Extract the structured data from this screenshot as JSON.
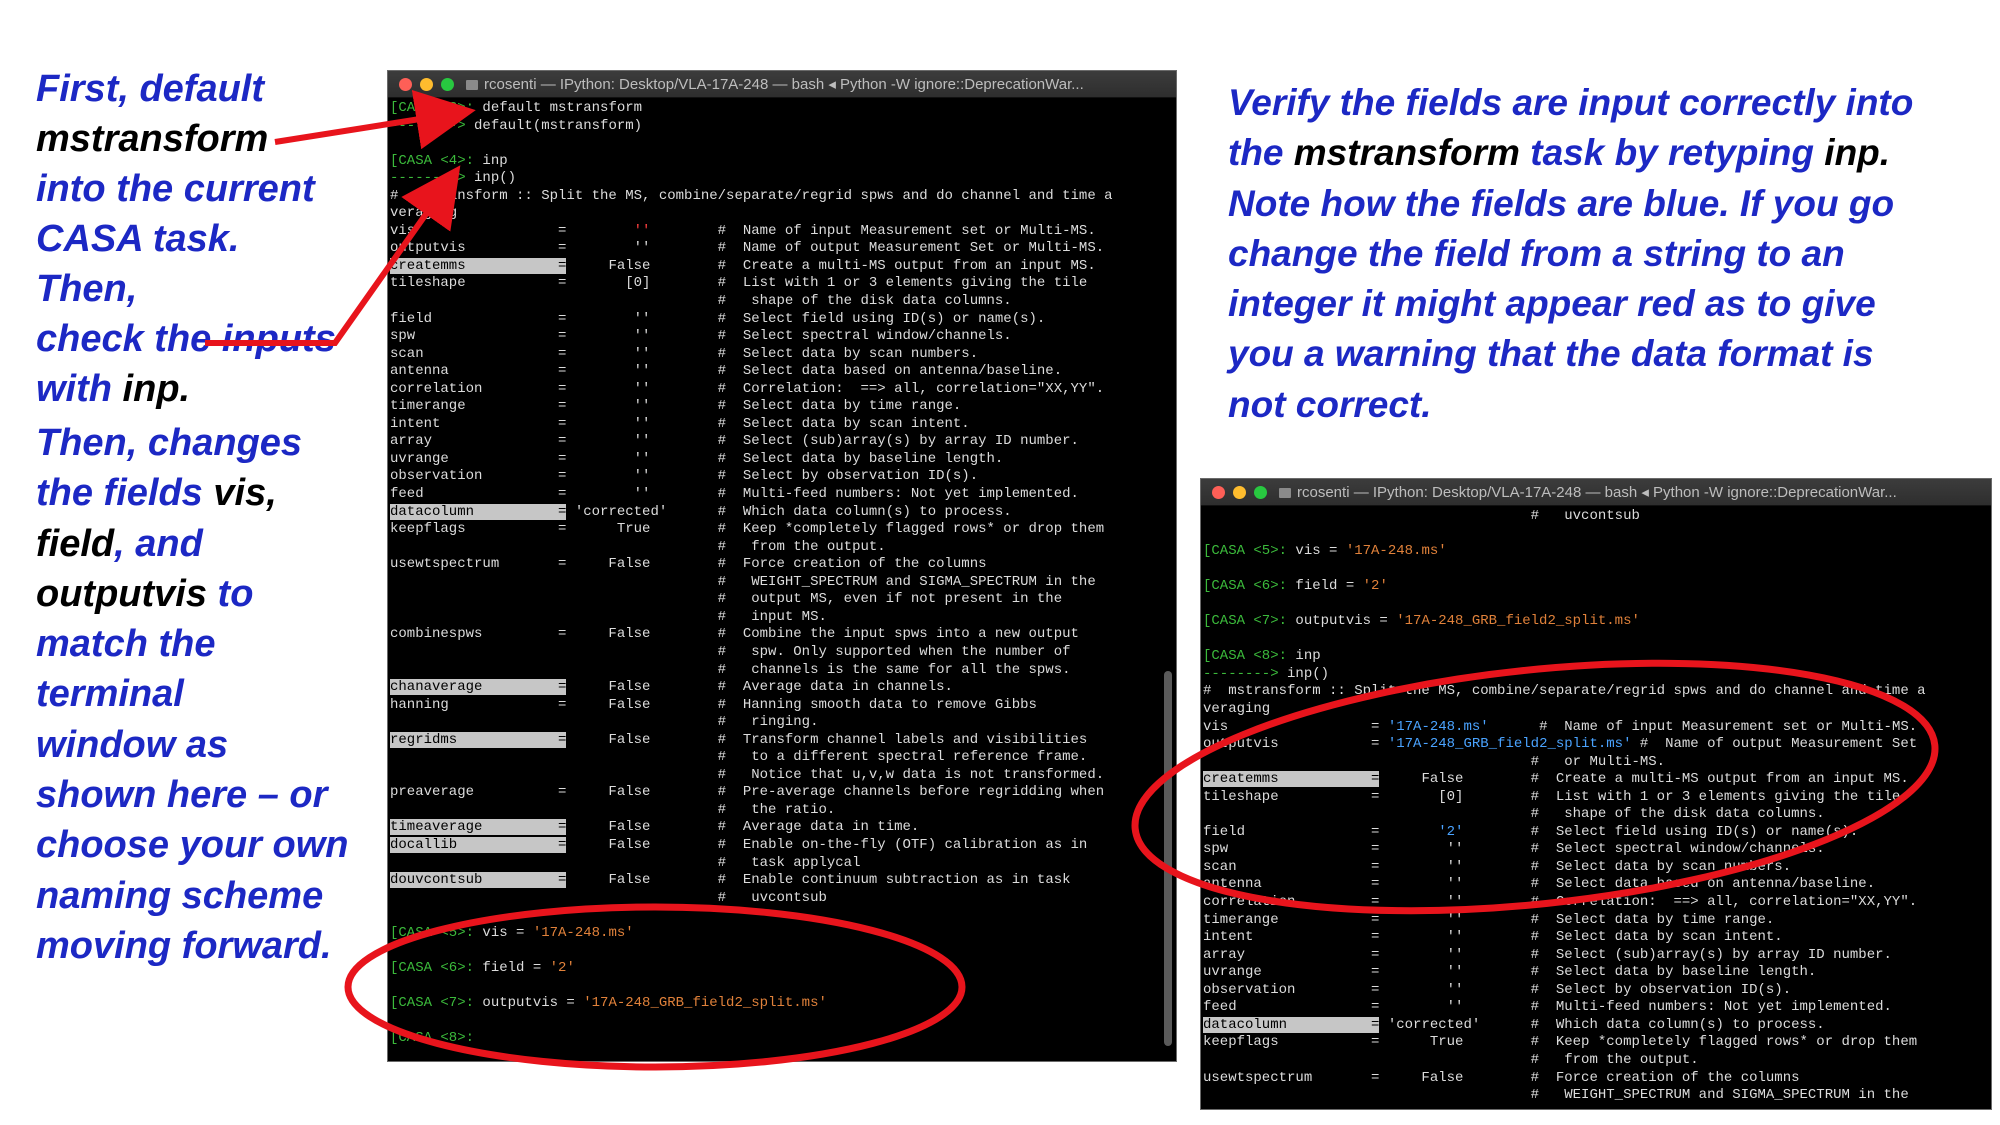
{
  "notes": {
    "left1": [
      "First, default",
      "mstransform",
      "into the current",
      "CASA task. Then,",
      "check the inputs",
      "with",
      "inp."
    ],
    "left2": [
      "Then, changes",
      "the fields",
      "vis,",
      "field",
      ", and",
      "outputvis",
      "to",
      "match the",
      "terminal",
      "window as",
      "shown here – or",
      "choose your own",
      "naming scheme",
      "moving forward."
    ],
    "right": [
      "Verify the fields are input correctly into",
      "the",
      "mstransform",
      "task by retyping",
      "inp.",
      "Note how the fields are blue. If you go",
      "change the field from a string to an",
      "integer it might appear red as to give",
      "you a warning that the data format is",
      "not correct."
    ]
  },
  "terminal1": {
    "title": "rcosenti — IPython: Desktop/VLA-17A-248 — bash ◂ Python -W ignore::DeprecationWar...",
    "lines": [
      "[CASA <3>: default mstransform",
      "--------> default(mstransform)",
      "",
      "[CASA <4>: inp",
      "--------> inp()",
      "#  mstransform :: Split the MS, combine/separate/regrid spws and do channel and time a",
      "veraging",
      "vis                 =        ''        #  Name of input Measurement set or Multi-MS.",
      "outputvis           =        ''        #  Name of output Measurement Set or Multi-MS.",
      "createmms           =     False        #  Create a multi-MS output from an input MS.",
      "tileshape           =       [0]        #  List with 1 or 3 elements giving the tile",
      "                                       #   shape of the disk data columns.",
      "field               =        ''        #  Select field using ID(s) or name(s).",
      "spw                 =        ''        #  Select spectral window/channels.",
      "scan                =        ''        #  Select data by scan numbers.",
      "antenna             =        ''        #  Select data based on antenna/baseline.",
      "correlation         =        ''        #  Correlation:  ==> all, correlation=\"XX,YY\".",
      "timerange           =        ''        #  Select data by time range.",
      "intent              =        ''        #  Select data by scan intent.",
      "array               =        ''        #  Select (sub)array(s) by array ID number.",
      "uvrange             =        ''        #  Select data by baseline length.",
      "observation         =        ''        #  Select by observation ID(s).",
      "feed                =        ''        #  Multi-feed numbers: Not yet implemented.",
      "datacolumn          = 'corrected'      #  Which data column(s) to process.",
      "keepflags           =      True        #  Keep *completely flagged rows* or drop them",
      "                                       #   from the output.",
      "usewtspectrum       =     False        #  Force creation of the columns",
      "                                       #   WEIGHT_SPECTRUM and SIGMA_SPECTRUM in the",
      "                                       #   output MS, even if not present in the",
      "                                       #   input MS.",
      "combinespws         =     False        #  Combine the input spws into a new output",
      "                                       #   spw. Only supported when the number of",
      "                                       #   channels is the same for all the spws.",
      "chanaverage         =     False        #  Average data in channels.",
      "hanning             =     False        #  Hanning smooth data to remove Gibbs",
      "                                       #   ringing.",
      "regridms            =     False        #  Transform channel labels and visibilities",
      "                                       #   to a different spectral reference frame.",
      "                                       #   Notice that u,v,w data is not transformed.",
      "preaverage          =     False        #  Pre-average channels before regridding when",
      "                                       #   the ratio.",
      "timeaverage         =     False        #  Average data in time.",
      "docallib            =     False        #  Enable on-the-fly (OTF) calibration as in",
      "                                       #   task applycal",
      "douvcontsub         =     False        #  Enable continuum subtraction as in task",
      "                                       #   uvcontsub",
      "",
      "[CASA <5>: vis = '17A-248.ms'",
      "",
      "[CASA <6>: field = '2'",
      "",
      "[CASA <7>: outputvis = '17A-248_GRB_field2_split.ms'",
      "",
      "[CASA <8>: "
    ]
  },
  "terminal2": {
    "title": "rcosenti — IPython: Desktop/VLA-17A-248 — bash ◂ Python -W ignore::DeprecationWar...",
    "lines": [
      "                                       #   uvcontsub",
      "",
      "[CASA <5>: vis = '17A-248.ms'",
      "",
      "[CASA <6>: field = '2'",
      "",
      "[CASA <7>: outputvis = '17A-248_GRB_field2_split.ms'",
      "",
      "[CASA <8>: inp",
      "--------> inp()",
      "#  mstransform :: Split the MS, combine/separate/regrid spws and do channel and time a",
      "veraging",
      "vis                 = '17A-248.ms'      #  Name of input Measurement set or Multi-MS.",
      "outputvis           = '17A-248_GRB_field2_split.ms' #  Name of output Measurement Set",
      "                                       #   or Multi-MS.",
      "createmms           =     False        #  Create a multi-MS output from an input MS.",
      "tileshape           =       [0]        #  List with 1 or 3 elements giving the tile",
      "                                       #   shape of the disk data columns.",
      "field               =       '2'        #  Select field using ID(s) or name(s).",
      "spw                 =        ''        #  Select spectral window/channels.",
      "scan                =        ''        #  Select data by scan numbers.",
      "antenna             =        ''        #  Select data based on antenna/baseline.",
      "correlation         =        ''        #  Correlation:  ==> all, correlation=\"XX,YY\".",
      "timerange           =        ''        #  Select data by time range.",
      "intent              =        ''        #  Select data by scan intent.",
      "array               =        ''        #  Select (sub)array(s) by array ID number.",
      "uvrange             =        ''        #  Select data by baseline length.",
      "observation         =        ''        #  Select by observation ID(s).",
      "feed                =        ''        #  Multi-feed numbers: Not yet implemented.",
      "datacolumn          = 'corrected'      #  Which data column(s) to process.",
      "keepflags           =      True        #  Keep *completely flagged rows* or drop them",
      "                                       #   from the output.",
      "usewtspectrum       =     False        #  Force creation of the columns",
      "                                       #   WEIGHT_SPECTRUM and SIGMA_SPECTRUM in the"
    ]
  },
  "colors": {
    "note_blue": "#1c28c4",
    "annotation_red": "#e8141c",
    "prompt_green": "#3bba3b",
    "string_orange": "#e0813a",
    "string_blue": "#4aa3ff"
  }
}
